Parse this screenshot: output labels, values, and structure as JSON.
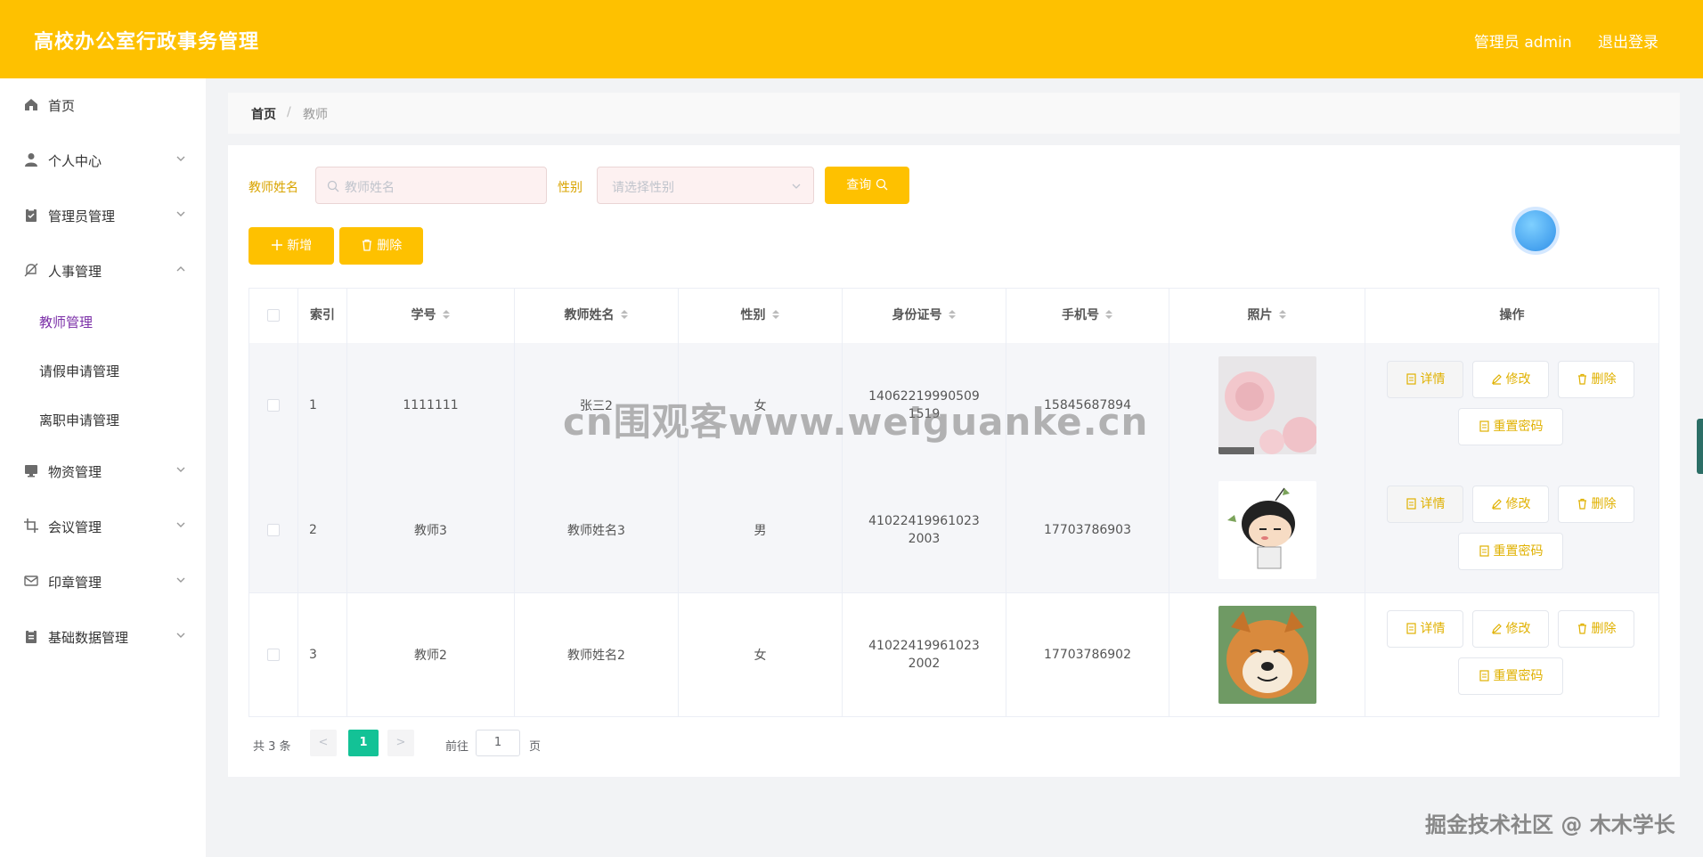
{
  "header": {
    "title": "高校办公室行政事务管理",
    "user": "管理员 admin",
    "logout": "退出登录"
  },
  "sidebar": {
    "items": [
      {
        "label": "首页",
        "icon": "home-icon"
      },
      {
        "label": "个人中心",
        "icon": "user-icon"
      },
      {
        "label": "管理员管理",
        "icon": "clipboard-icon"
      },
      {
        "label": "人事管理",
        "icon": "bell-off-icon"
      },
      {
        "label": "物资管理",
        "icon": "monitor-icon"
      },
      {
        "label": "会议管理",
        "icon": "crop-icon"
      },
      {
        "label": "印章管理",
        "icon": "mail-icon"
      },
      {
        "label": "基础数据管理",
        "icon": "clipboard-icon"
      }
    ],
    "sub_items": [
      {
        "label": "教师管理",
        "active": true
      },
      {
        "label": "请假申请管理",
        "active": false
      },
      {
        "label": "离职申请管理",
        "active": false
      }
    ]
  },
  "breadcrumb": {
    "home": "首页",
    "sep": "/",
    "current": "教师"
  },
  "filters": {
    "name_label": "教师姓名",
    "name_placeholder": "教师姓名",
    "gender_label": "性别",
    "gender_placeholder": "请选择性别",
    "query_button": "查询"
  },
  "actions": {
    "add": "新增",
    "delete": "删除"
  },
  "table": {
    "columns": [
      "索引",
      "学号",
      "教师姓名",
      "性别",
      "身份证号",
      "手机号",
      "照片",
      "操作"
    ],
    "rows": [
      {
        "index": "1",
        "id": "1111111",
        "name": "张三2",
        "gender": "女",
        "idcard": "140622199905091519",
        "phone": "15845687894",
        "photo": "pink-rose"
      },
      {
        "index": "2",
        "id": "教师3",
        "name": "教师姓名3",
        "gender": "男",
        "idcard": "410224199610232003",
        "phone": "17703786903",
        "photo": "cartoon-boy"
      },
      {
        "index": "3",
        "id": "教师2",
        "name": "教师姓名2",
        "gender": "女",
        "idcard": "410224199610232002",
        "phone": "17703786902",
        "photo": "shiba-dog"
      }
    ],
    "row_actions": {
      "detail": "详情",
      "edit": "修改",
      "delete": "删除",
      "reset": "重置密码"
    }
  },
  "pagination": {
    "total": "共 3 条",
    "prev": "<",
    "current": "1",
    "next": ">",
    "goto": "前往",
    "page_value": "1",
    "page": "页"
  },
  "watermarks": {
    "center": "cn围观客www.weiguanke.cn",
    "corner": "掘金技术社区 @ 木木学长"
  },
  "colors": {
    "header": "#fec100",
    "active_menu": "#7b2fa8",
    "current_page": "#13c296"
  }
}
